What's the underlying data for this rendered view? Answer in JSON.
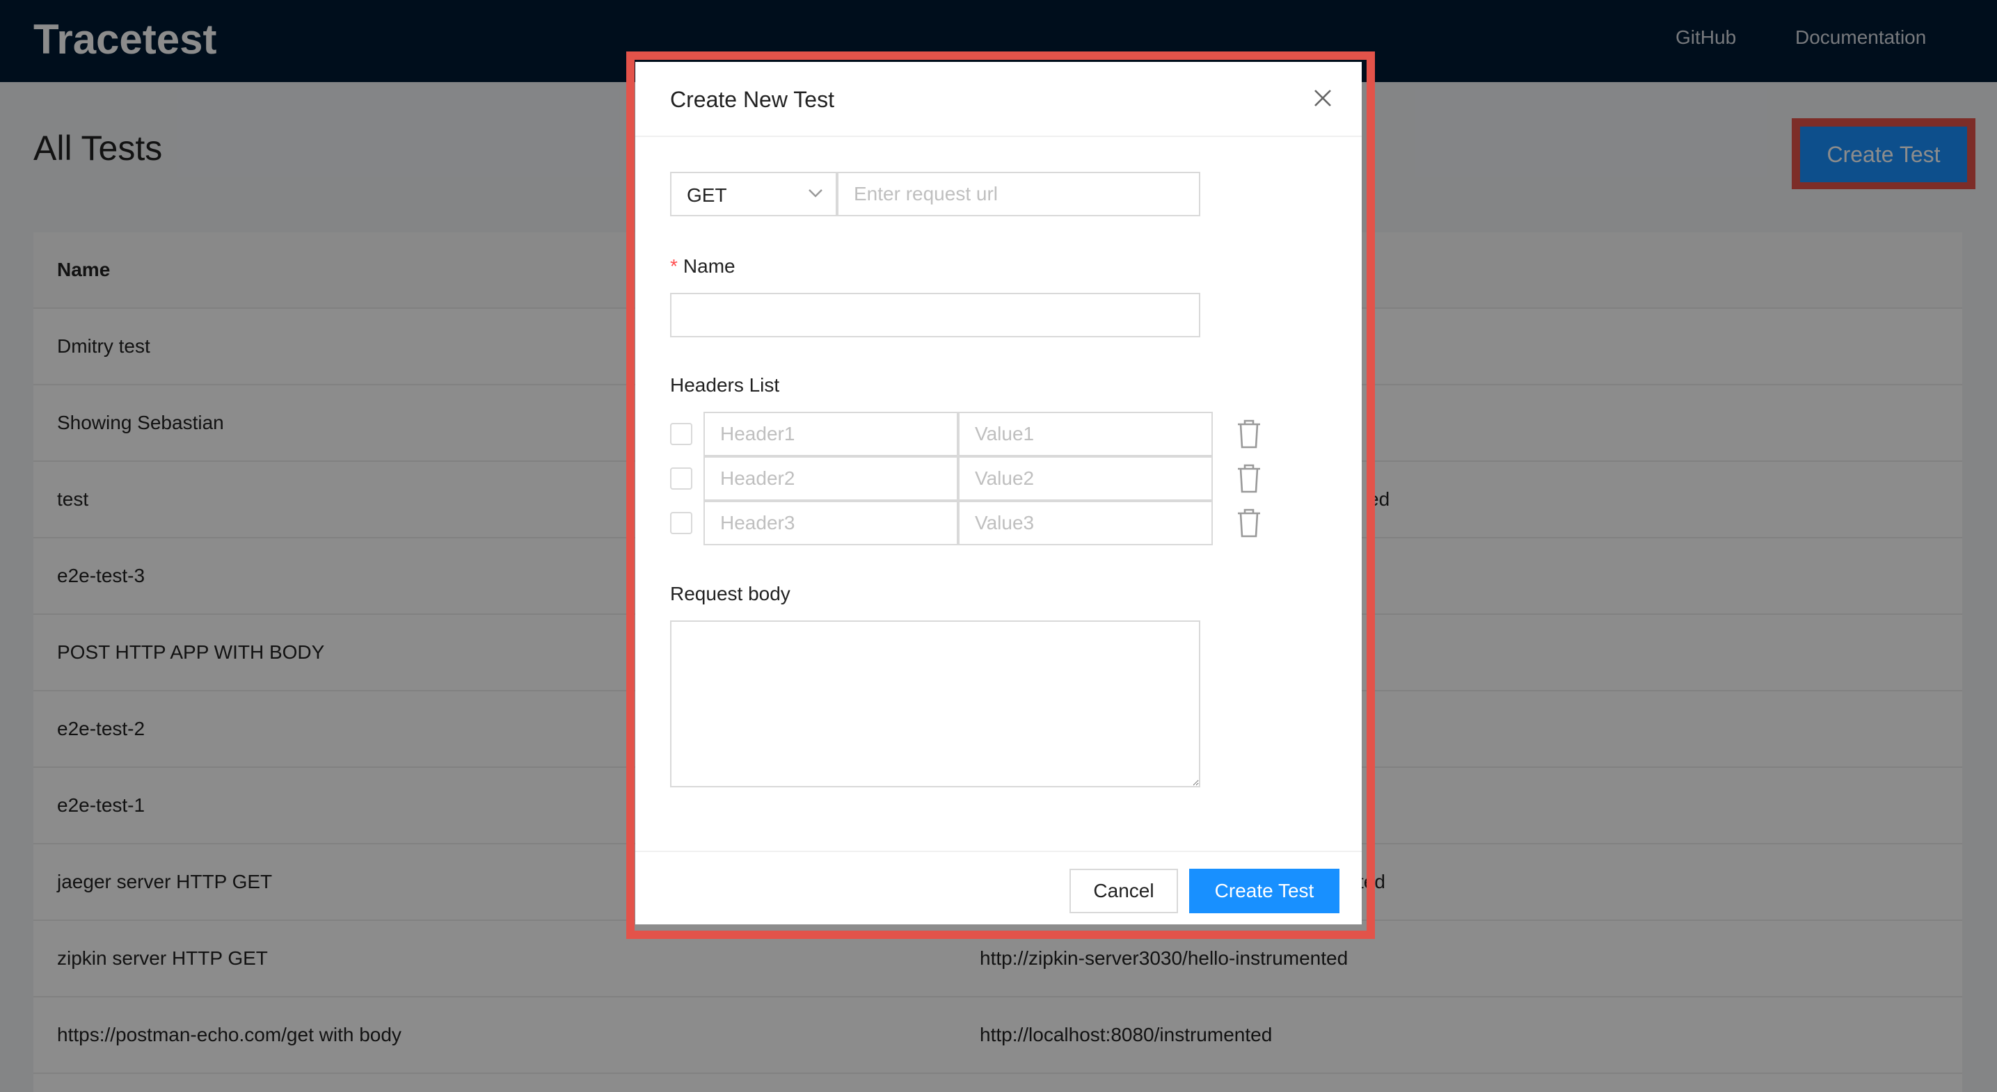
{
  "app": {
    "brand": "Tracetest",
    "nav": [
      {
        "label": "GitHub"
      },
      {
        "label": "Documentation"
      }
    ]
  },
  "page": {
    "title": "All Tests",
    "create_button": "Create Test"
  },
  "table": {
    "columns": {
      "name": "Name"
    },
    "rows": [
      {
        "name": "Dmitry test",
        "url": ""
      },
      {
        "name": "Showing Sebastian",
        "url": ""
      },
      {
        "name": "test",
        "url": "ed"
      },
      {
        "name": "e2e-test-3",
        "url": ""
      },
      {
        "name": "POST HTTP APP WITH BODY",
        "url": ""
      },
      {
        "name": "e2e-test-2",
        "url": ""
      },
      {
        "name": "e2e-test-1",
        "url": ""
      },
      {
        "name": "jaeger server HTTP GET",
        "url": "ted"
      },
      {
        "name": "zipkin server HTTP GET",
        "url": "http://zipkin-server3030/hello-instrumented"
      },
      {
        "name": "https://postman-echo.com/get with body",
        "url": "http://localhost:8080/instrumented"
      }
    ]
  },
  "modal": {
    "title": "Create New Test",
    "method": {
      "selected": "GET"
    },
    "url": {
      "placeholder": "Enter request url",
      "value": ""
    },
    "name_field": {
      "label": "Name",
      "required_mark": "*",
      "value": ""
    },
    "headers": {
      "label": "Headers List",
      "rows": [
        {
          "key_placeholder": "Header1",
          "value_placeholder": "Value1"
        },
        {
          "key_placeholder": "Header2",
          "value_placeholder": "Value2"
        },
        {
          "key_placeholder": "Header3",
          "value_placeholder": "Value3"
        }
      ]
    },
    "body": {
      "label": "Request body",
      "value": ""
    },
    "cancel_label": "Cancel",
    "submit_label": "Create Test"
  },
  "colors": {
    "topbar": "#011a33",
    "primary": "#1890ff",
    "highlight": "#e3534a",
    "required": "#ff4d4f"
  },
  "icons": [
    "close-icon",
    "chevron-down-icon",
    "trash-icon"
  ]
}
